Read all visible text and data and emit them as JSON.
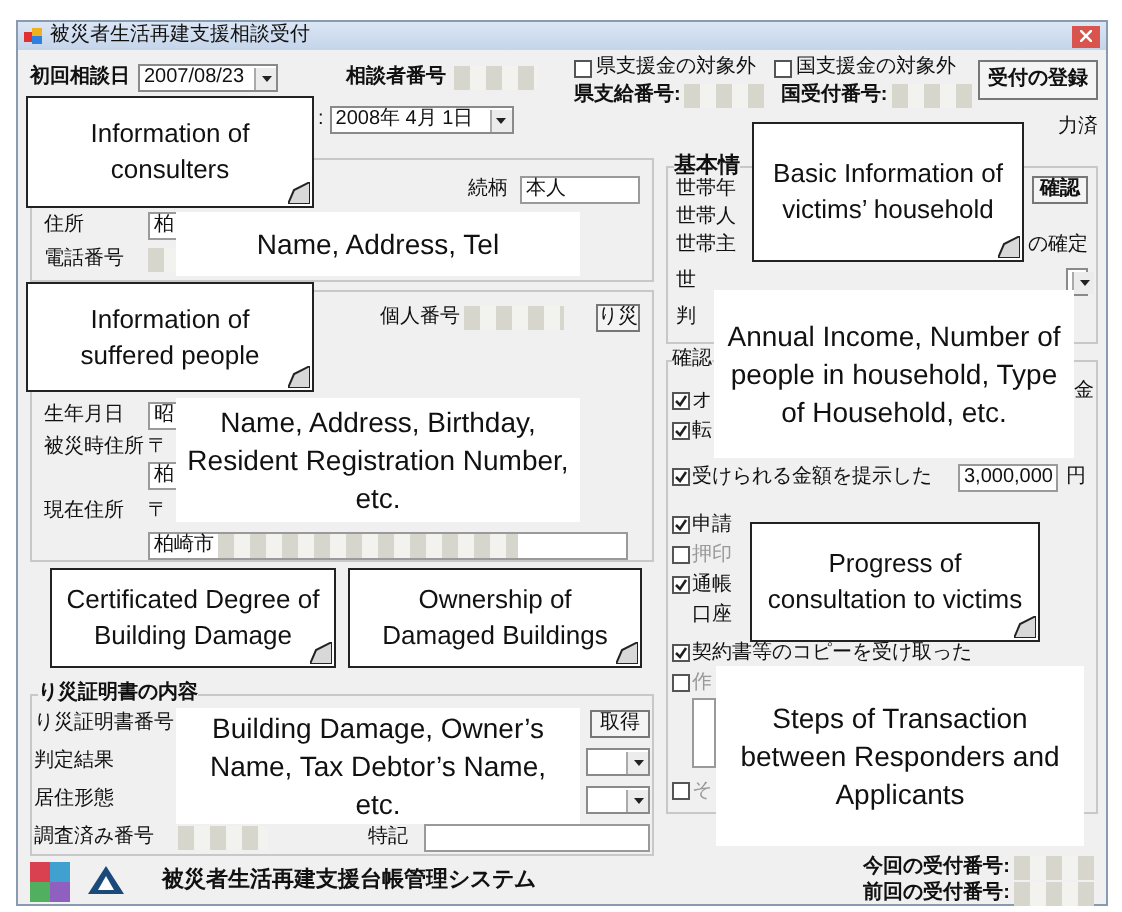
{
  "window": {
    "title": "被災者生活再建支援相談受付"
  },
  "header": {
    "first_consult_label": "初回相談日",
    "first_consult_date": "2007/08/23",
    "consultant_no_label": "相談者番号",
    "exclusions": [
      {
        "label": "県支援金の対象外",
        "checked": false
      },
      {
        "label": "国支援金の対象外",
        "checked": false
      }
    ],
    "numbers": [
      "県支給番号:",
      "国受付番号:"
    ],
    "register_button": "受付の登録",
    "date_prefix": ":",
    "date_value": "2008年 4月 1日",
    "entered_label": "力済"
  },
  "consulter": {
    "relation_label": "続柄",
    "relation_value": "本人",
    "address_label": "住所",
    "address_value": "柏",
    "phone_label": "電話番号"
  },
  "victim": {
    "id_label": "個人番号",
    "certificate_button": "り災",
    "birth_label": "生年月日",
    "birth_value": "昭",
    "disaster_address_label": "被災時住所",
    "disaster_postal_mark": "〒",
    "disaster_address_value": "柏",
    "current_address_label": "現在住所",
    "current_postal_mark": "〒",
    "current_address_value": "柏崎市"
  },
  "certificate": {
    "title": "り災証明書の内容",
    "number_label": "り災証明書番号",
    "get_button": "取得",
    "result_label": "判定結果",
    "residence_label": "居住形態",
    "survey_label": "調査済み番号",
    "note_label": "特記"
  },
  "basic": {
    "title": "基本情",
    "rows": [
      "世帯年",
      "世帯人",
      "世帯主",
      "世",
      "判"
    ],
    "confirm_button": "確認",
    "fixed_label": "の確定"
  },
  "checks": {
    "title": "確認",
    "side_label": "金",
    "items": [
      {
        "kind": "check",
        "label": "オ",
        "checked": true
      },
      {
        "kind": "check",
        "label": "転",
        "checked": true
      },
      {
        "kind": "amount",
        "label": "受けられる金額を提示した",
        "checked": true,
        "amount": "3,000,000",
        "unit": "円"
      },
      {
        "kind": "check",
        "label": "申請",
        "checked": true
      },
      {
        "kind": "check",
        "label": "押印",
        "checked": false
      },
      {
        "kind": "check",
        "label": "通帳",
        "checked": true
      },
      {
        "kind": "text",
        "label": "口座"
      },
      {
        "kind": "check",
        "label": "契約書等のコピーを受け取った",
        "checked": true
      },
      {
        "kind": "check",
        "label": "作",
        "checked": false
      },
      {
        "kind": "list"
      },
      {
        "kind": "check",
        "label": "そ",
        "checked": false
      }
    ]
  },
  "footer": {
    "system_name": "被災者生活再建支援台帳管理システム",
    "current_no_label": "今回の受付番号:",
    "previous_no_label": "前回の受付番号:"
  },
  "annotations": [
    {
      "kind": "callout",
      "text": "Information of consulters"
    },
    {
      "kind": "label",
      "text": "Name, Address, Tel"
    },
    {
      "kind": "callout",
      "text": "Information of suffered people"
    },
    {
      "kind": "label",
      "text": "Name, Address, Birthday, Resident Registration Number, etc."
    },
    {
      "kind": "callout",
      "text": "Certificated Degree of Building Damage"
    },
    {
      "kind": "callout",
      "text": "Ownership of Damaged Buildings"
    },
    {
      "kind": "label",
      "text": "Building Damage, Owner’s Name, Tax Debtor’s Name, etc."
    },
    {
      "kind": "callout",
      "text": "Basic Information of victims’ household"
    },
    {
      "kind": "label",
      "text": "Annual Income, Number of people in household, Type of Household, etc."
    },
    {
      "kind": "callout",
      "text": "Progress of consultation to victims"
    },
    {
      "kind": "label",
      "text": "Steps of Transaction between Responders and Applicants"
    }
  ]
}
